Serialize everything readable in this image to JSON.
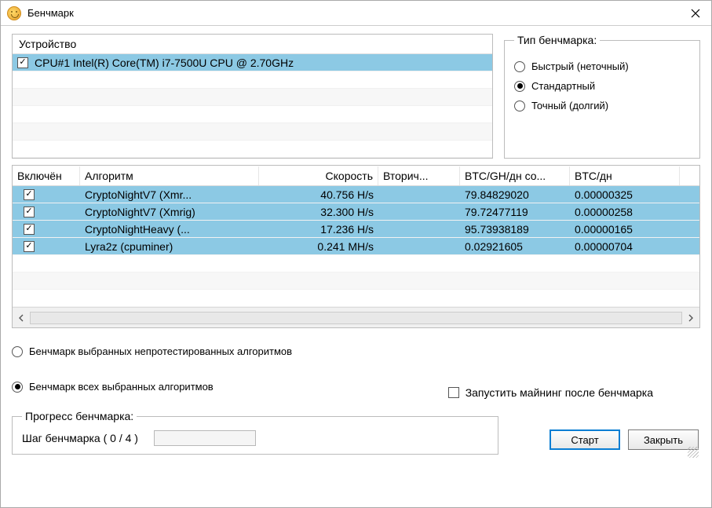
{
  "window": {
    "title": "Бенчмарк"
  },
  "devices": {
    "header": "Устройство",
    "items": [
      {
        "checked": true,
        "name": "CPU#1 Intel(R) Core(TM) i7-7500U CPU @ 2.70GHz",
        "selected": true
      }
    ]
  },
  "benchmark_type": {
    "legend": "Тип бенчмарка:",
    "options": [
      {
        "label": "Быстрый (неточный)",
        "checked": false
      },
      {
        "label": "Стандартный",
        "checked": true
      },
      {
        "label": "Точный (долгий)",
        "checked": false
      }
    ]
  },
  "algo_table": {
    "headers": {
      "enabled": "Включён",
      "algo": "Алгоритм",
      "speed": "Скорость",
      "secondary": "Вторич...",
      "ratio": "BTC/GH/дн со...",
      "btc": "BTC/дн"
    },
    "rows": [
      {
        "enabled": true,
        "algo": "CryptoNightV7 (Xmr...",
        "speed": "40.756 H/s",
        "secondary": "",
        "ratio": "79.84829020",
        "btc": "0.00000325"
      },
      {
        "enabled": true,
        "algo": "CryptoNightV7 (Xmrig)",
        "speed": "32.300 H/s",
        "secondary": "",
        "ratio": "79.72477119",
        "btc": "0.00000258"
      },
      {
        "enabled": true,
        "algo": "CryptoNightHeavy (...",
        "speed": "17.236 H/s",
        "secondary": "",
        "ratio": "95.73938189",
        "btc": "0.00000165"
      },
      {
        "enabled": true,
        "algo": "Lyra2z (cpuminer)",
        "speed": "0.241 MH/s",
        "secondary": "",
        "ratio": "0.02921605",
        "btc": "0.00000704"
      }
    ]
  },
  "scope": {
    "options": [
      {
        "label": "Бенчмарк выбранных непротестированных алгоритмов",
        "checked": false
      },
      {
        "label": "Бенчмарк всех выбранных алгоритмов",
        "checked": true
      }
    ]
  },
  "start_mining": {
    "label": "Запустить майнинг после бенчмарка",
    "checked": false
  },
  "progress": {
    "legend": "Прогресс бенчмарка:",
    "step_label": "Шаг бенчмарка ( 0 / 4 )"
  },
  "buttons": {
    "start": "Старт",
    "close": "Закрыть"
  }
}
